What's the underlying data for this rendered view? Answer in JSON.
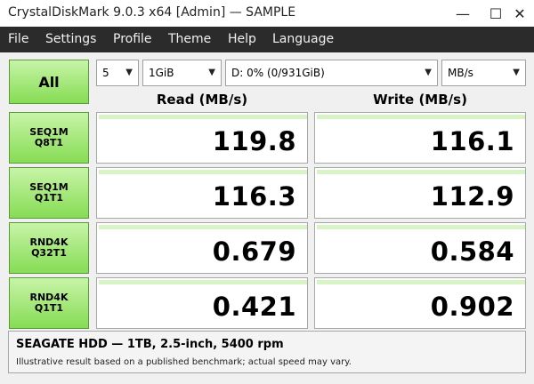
{
  "window": {
    "title": "CrystalDiskMark 9.0.3 x64 [Admin] — SAMPLE",
    "minimize_glyph": "—",
    "maximize_glyph": "☐",
    "close_glyph": "✕"
  },
  "menu": [
    "File",
    "Settings",
    "Profile",
    "Theme",
    "Help",
    "Language"
  ],
  "controls": {
    "all_label": "All",
    "count": "5",
    "size": "1GiB",
    "drive": "D: 0% (0/931GiB)",
    "unit": "MB/s",
    "arrow": "▼"
  },
  "headers": {
    "read": "Read (MB/s)",
    "write": "Write (MB/s)"
  },
  "tests": [
    {
      "line1": "SEQ1M",
      "line2": "Q8T1",
      "read": "119.8",
      "write": "116.1"
    },
    {
      "line1": "SEQ1M",
      "line2": "Q1T1",
      "read": "116.3",
      "write": "112.9"
    },
    {
      "line1": "RND4K",
      "line2": "Q32T1",
      "read": "0.679",
      "write": "0.584"
    },
    {
      "line1": "RND4K",
      "line2": "Q1T1",
      "read": "0.421",
      "write": "0.902"
    }
  ],
  "footer": {
    "device": "SEAGATE HDD — 1TB, 2.5-inch, 5400 rpm",
    "note": "Illustrative result based on a published benchmark; actual speed may vary."
  },
  "colors": {
    "button_green_top": "#c8f4a8",
    "button_green_bottom": "#86dc54",
    "menubar_bg": "#2b2b2b",
    "progress_bar": "#d8f3c6"
  }
}
